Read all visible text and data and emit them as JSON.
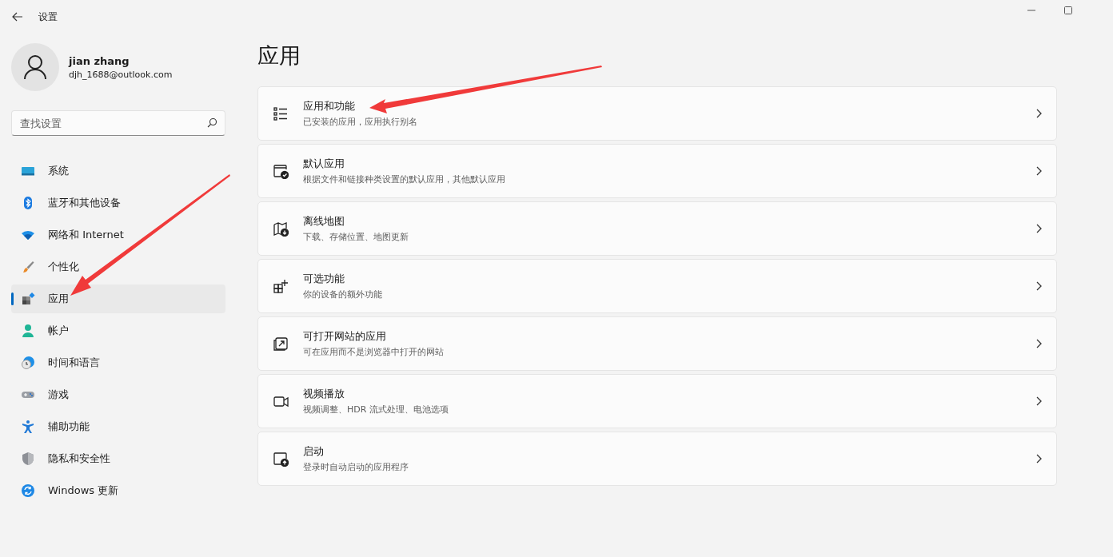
{
  "window": {
    "title": "设置"
  },
  "user": {
    "name": "jian zhang",
    "email": "djh_1688@outlook.com"
  },
  "search": {
    "placeholder": "查找设置"
  },
  "sidebar": {
    "items": [
      {
        "label": "系统",
        "selected": false
      },
      {
        "label": "蓝牙和其他设备",
        "selected": false
      },
      {
        "label": "网络和 Internet",
        "selected": false
      },
      {
        "label": "个性化",
        "selected": false
      },
      {
        "label": "应用",
        "selected": true
      },
      {
        "label": "帐户",
        "selected": false
      },
      {
        "label": "时间和语言",
        "selected": false
      },
      {
        "label": "游戏",
        "selected": false
      },
      {
        "label": "辅助功能",
        "selected": false
      },
      {
        "label": "隐私和安全性",
        "selected": false
      },
      {
        "label": "Windows 更新",
        "selected": false
      }
    ]
  },
  "page": {
    "title": "应用",
    "cards": [
      {
        "title": "应用和功能",
        "subtitle": "已安装的应用，应用执行别名"
      },
      {
        "title": "默认应用",
        "subtitle": "根据文件和链接种类设置的默认应用，其他默认应用"
      },
      {
        "title": "离线地图",
        "subtitle": "下载、存储位置、地图更新"
      },
      {
        "title": "可选功能",
        "subtitle": "你的设备的额外功能"
      },
      {
        "title": "可打开网站的应用",
        "subtitle": "可在应用而不是浏览器中打开的网站"
      },
      {
        "title": "视频播放",
        "subtitle": "视频调整、HDR 流式处理、电池选项"
      },
      {
        "title": "启动",
        "subtitle": "登录时自动启动的应用程序"
      }
    ]
  }
}
